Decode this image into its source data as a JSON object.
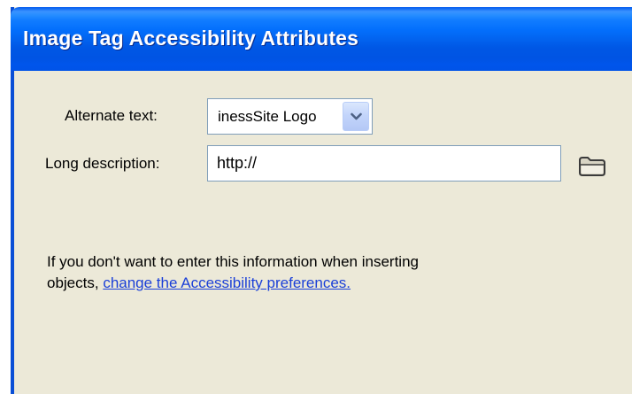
{
  "dialog": {
    "title": "Image Tag Accessibility Attributes"
  },
  "alt_text": {
    "label": "Alternate text:",
    "value": "inessSite Logo",
    "dropdown_icon": "chevron-down-icon"
  },
  "long_desc": {
    "label": "Long description:",
    "value": "http://",
    "browse_icon": "folder-icon"
  },
  "help": {
    "line1": "If you don't want to enter this information when inserting",
    "line2_prefix": "objects, ",
    "link": "change the Accessibility preferences."
  },
  "colors": {
    "titlebar": "#0055e5",
    "dialog_bg": "#ece9d8",
    "link": "#1a3fd8",
    "field_border": "#7f9db9"
  }
}
